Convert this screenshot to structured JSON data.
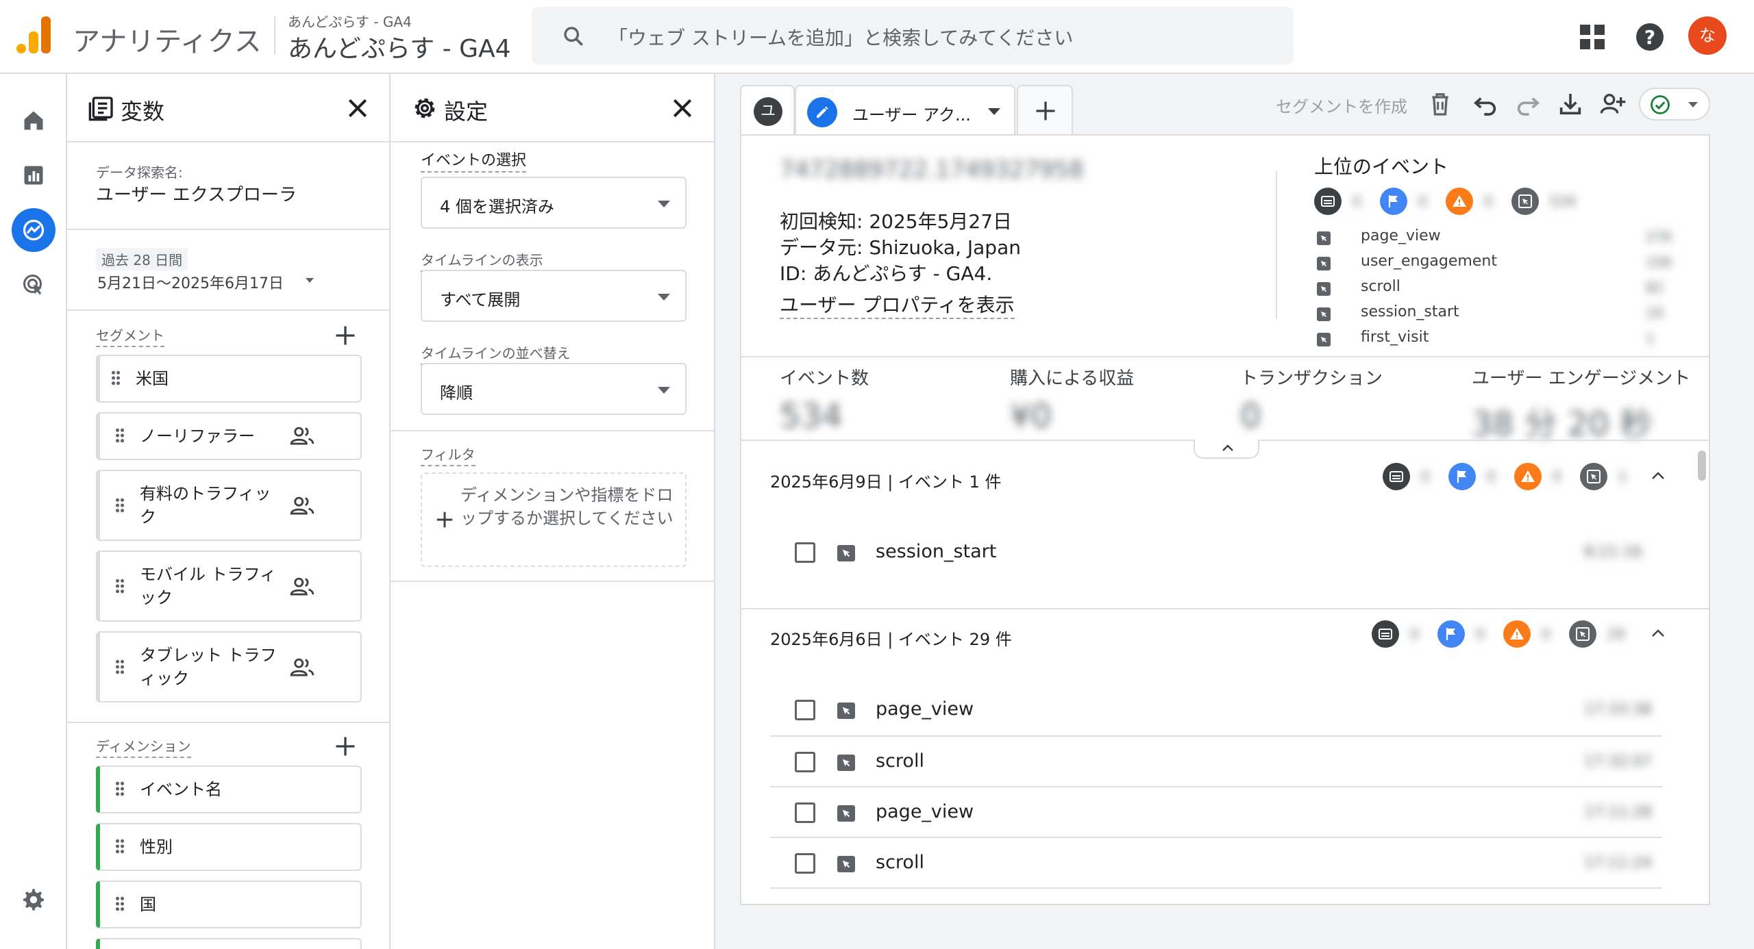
{
  "header": {
    "app_title": "アナリティクス",
    "property_sub": "あんどぷらす - GA4",
    "property_name": "あんどぷらす - GA4",
    "search_placeholder": "「ウェブ ストリームを追加」と検索してみてください",
    "avatar_initial": "な",
    "accent_color": "#1a73e8"
  },
  "rail": {
    "items": [
      "home-icon",
      "reports-icon",
      "explore-icon",
      "advertising-icon"
    ],
    "active": "explore-icon",
    "bottom": "settings-icon"
  },
  "variables": {
    "title": "変数",
    "exploration_name_label": "データ探索名:",
    "exploration_name": "ユーザー エクスプローラ",
    "date_range_label": "過去 28 日間",
    "date_range": "5月21日〜2025年6月17日",
    "segments_label": "セグメント",
    "segments": [
      "米国",
      "ノーリファラー",
      "有料のトラフィック",
      "モバイル トラフィック",
      "タブレット トラフィック"
    ],
    "dimensions_label": "ディメンション",
    "dimensions": [
      "イベント名",
      "性別",
      "国"
    ]
  },
  "settings": {
    "title": "設定",
    "event_select_label": "イベントの選択",
    "event_select_value": "4 個を選択済み",
    "timeline_display_label": "タイムラインの表示",
    "timeline_display_value": "すべて展開",
    "timeline_sort_label": "タイムラインの並べ替え",
    "timeline_sort_value": "降順",
    "filter_label": "フィルタ",
    "filter_placeholder": "ディメンションや指標をドロップするか選択してください"
  },
  "canvas": {
    "tab_user_badge": "ユ",
    "tab_label": "ユーザー アク...",
    "toolbar_create_segment": "セグメントを作成",
    "user_id": "7472889722.1749327958",
    "first_seen": "初回検知: 2025年5月27日",
    "data_source": "データ元: Shizuoka, Japan",
    "stream_id": "ID: あんどぷらす - GA4.",
    "show_user_properties": "ユーザー プロパティを表示",
    "top_events_title": "上位のイベント",
    "top_event_counts": [
      "0",
      "0",
      "0",
      "534"
    ],
    "top_events": [
      {
        "name": "page_view",
        "count": "276"
      },
      {
        "name": "user_engagement",
        "count": "156"
      },
      {
        "name": "scroll",
        "count": "82"
      },
      {
        "name": "session_start",
        "count": "19"
      },
      {
        "name": "first_visit",
        "count": "1"
      }
    ],
    "metrics": [
      {
        "label": "イベント数",
        "value": "534"
      },
      {
        "label": "購入による収益",
        "value": "¥0"
      },
      {
        "label": "トランザクション",
        "value": "0"
      },
      {
        "label": "ユーザー エンゲージメント",
        "value": "38 分 20 秒"
      }
    ],
    "days": [
      {
        "header": "2025年6月9日 | イベント 1 件",
        "counts": [
          "0",
          "0",
          "0",
          "1"
        ],
        "events": [
          {
            "name": "session_start",
            "time": "8:21:16"
          }
        ]
      },
      {
        "header": "2025年6月6日 | イベント 29 件",
        "counts": [
          "0",
          "0",
          "0",
          "29"
        ],
        "events": [
          {
            "name": "page_view",
            "time": "17:33:38"
          },
          {
            "name": "scroll",
            "time": "17:32:07"
          },
          {
            "name": "page_view",
            "time": "17:11:28"
          },
          {
            "name": "scroll",
            "time": "17:11:24"
          }
        ]
      }
    ]
  }
}
